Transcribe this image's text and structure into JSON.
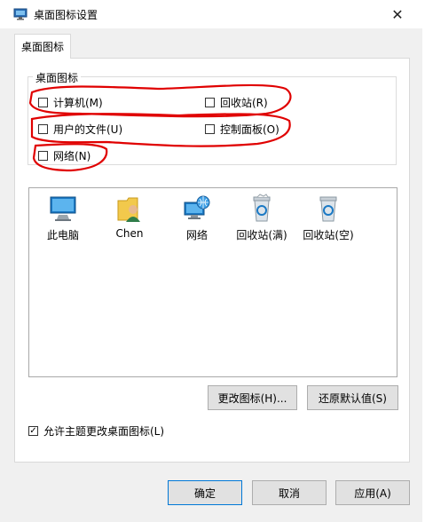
{
  "window": {
    "title": "桌面图标设置"
  },
  "tab": {
    "label": "桌面图标"
  },
  "group": {
    "label": "桌面图标",
    "checkboxes": [
      {
        "label": "计算机(M)",
        "checked": false
      },
      {
        "label": "回收站(R)",
        "checked": false
      },
      {
        "label": "用户的文件(U)",
        "checked": false
      },
      {
        "label": "控制面板(O)",
        "checked": false
      },
      {
        "label": "网络(N)",
        "checked": false
      }
    ]
  },
  "icons": [
    {
      "label": "此电脑",
      "icon": "computer-icon"
    },
    {
      "label": "Chen",
      "icon": "user-folder-icon"
    },
    {
      "label": "网络",
      "icon": "network-icon"
    },
    {
      "label": "回收站(满)",
      "icon": "recycle-bin-full-icon"
    },
    {
      "label": "回收站(空)",
      "icon": "recycle-bin-empty-icon"
    }
  ],
  "buttons": {
    "change_icon": "更改图标(H)...",
    "restore_default": "还原默认值(S)",
    "ok": "确定",
    "cancel": "取消",
    "apply": "应用(A)"
  },
  "allow_themes": {
    "label": "允许主题更改桌面图标(L)",
    "checked": true
  },
  "colors": {
    "annotation": "#e00000",
    "accent": "#0078d7"
  }
}
